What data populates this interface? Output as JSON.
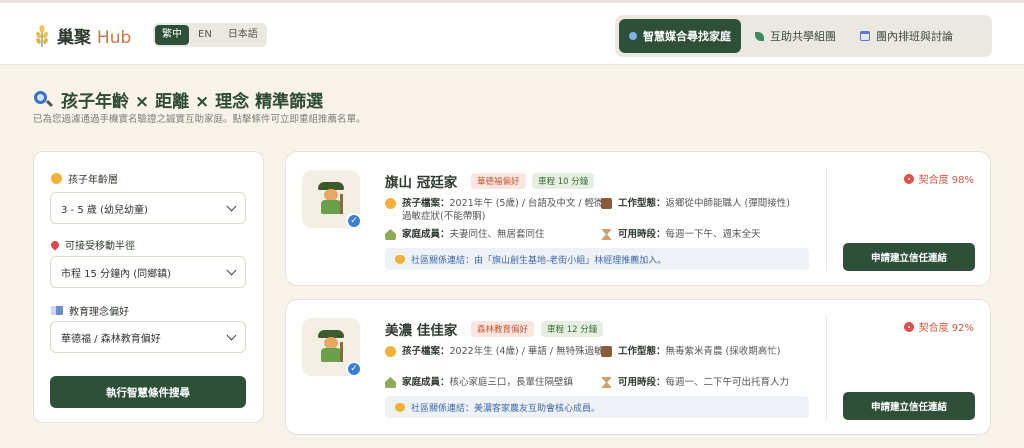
{
  "header": {
    "logo_text": "巢聚",
    "logo_hub": "Hub",
    "languages": [
      "繁中",
      "EN",
      "日本語"
    ],
    "active_language": "繁中",
    "nav": [
      {
        "label": "智慧媒合尋找家庭",
        "icon": "blue-dot-icon",
        "active": true
      },
      {
        "label": "互助共學組團",
        "icon": "leaf-icon",
        "active": false
      },
      {
        "label": "團內排班與討論",
        "icon": "calendar-icon",
        "active": false
      }
    ]
  },
  "hero": {
    "title": "孩子年齡 × 距離 × 理念 精準篩選",
    "subtitle": "已為您過濾通過手機實名驗證之誠實互助家庭。點擊條件可立即重組推薦名單。"
  },
  "filter": {
    "age_label": "孩子年齡層",
    "age_value": "3 - 5 歲 (幼兒幼童)",
    "distance_label": "可接受移動半徑",
    "distance_value": "市程 15 分鐘內 (同鄉鎮)",
    "philosophy_label": "教育理念偏好",
    "philosophy_value": "華德福 / 森林教育偏好",
    "search_button": "執行智慧條件搜尋"
  },
  "families": [
    {
      "name": "旗山 冠廷家",
      "pref_tag": "華德福偏好",
      "distance_tag": "車程 10 分鐘",
      "child_label": "孩子檔案：",
      "child_value": "2021年午 (5歲) / 台語及中文 / 輕微過敏症狀(不能帶胴)",
      "work_label": "工作型態：",
      "work_value": "返鄉從中師能職人 (彈間接性)",
      "members_label": "家庭成員：",
      "members_value": "夫妻同住、無居套同住",
      "time_label": "可用時段：",
      "time_value": "每週一下午、週末全天",
      "link_text": "社區關係連結：由「旗山創生基地-老街小組」林經理推薦加入。",
      "match": "契合度 98%",
      "apply_button": "申請建立信任連結"
    },
    {
      "name": "美濃 佳佳家",
      "pref_tag": "森林教育偏好",
      "distance_tag": "車程 12 分鐘",
      "child_label": "孩子檔案：",
      "child_value": "2022年生 (4歲) / 華語 / 無特殊過敏",
      "work_label": "工作型態：",
      "work_value": "無毒紫米青農 (採收期高忙)",
      "members_label": "家庭成員：",
      "members_value": "核心家庭三口，長輩住隔壁鎮",
      "time_label": "可用時段：",
      "time_value": "每週一、二下午可出托育人力",
      "link_text": "社區關係連結：美濃客家農友互助會核心成員。",
      "match": "契合度 92%",
      "apply_button": "申請建立信任連結"
    }
  ],
  "colors": {
    "primary": "#2f5038",
    "accent": "#c9784b",
    "background": "#f7f3ea",
    "match": "#d0573f"
  }
}
